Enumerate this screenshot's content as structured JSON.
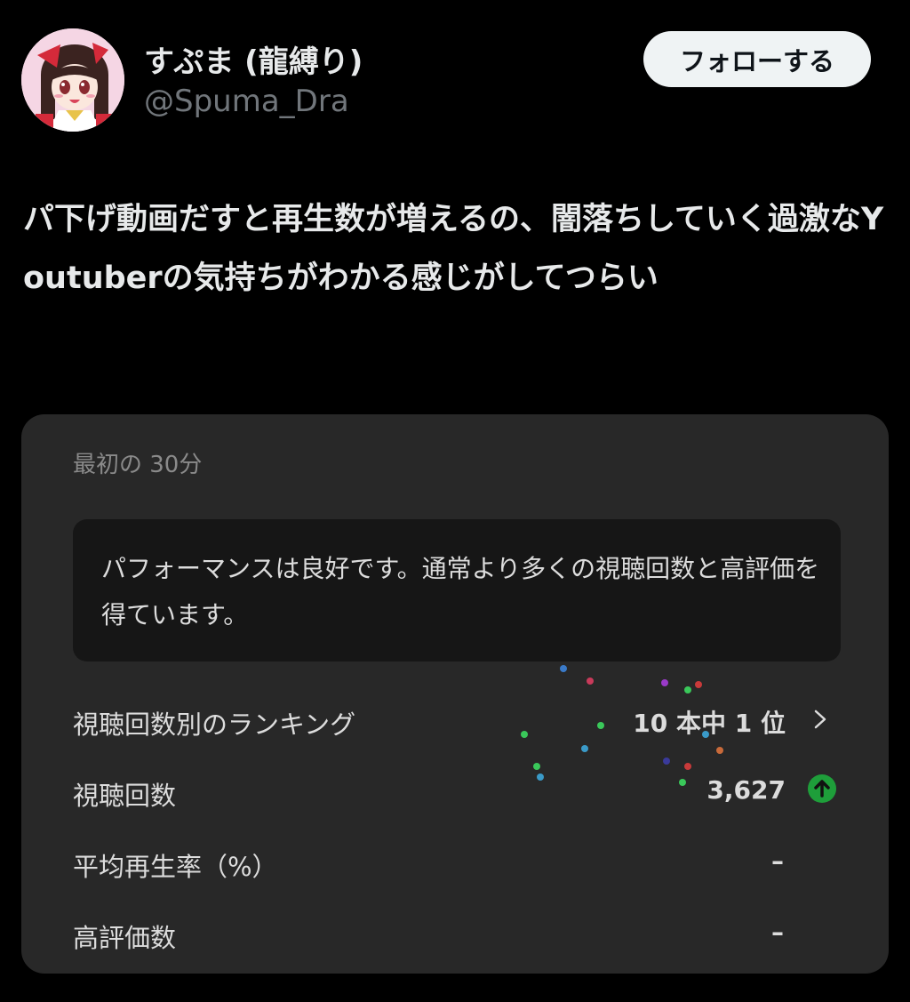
{
  "user": {
    "display_name": "すぷま (龍縛り)",
    "handle": "@Spuma_Dra",
    "avatar_icon": "avatar-image"
  },
  "follow_button": {
    "label": "フォローする"
  },
  "tweet": {
    "text": "パ下げ動画だすと再生数が増えるの、闇落ちしていく過激なYoutuberの気持ちがわかる感じがしてつらい"
  },
  "card": {
    "header": "最初の 30分",
    "performance_message": "パフォーマンスは良好です。通常より多くの視聴回数と高評価を得ています。",
    "rows": [
      {
        "label": "視聴回数別のランキング",
        "value": "10 本中 1 位",
        "icon": "chevron-right-icon"
      },
      {
        "label": "視聴回数",
        "value": "3,627",
        "icon": "arrow-up-circle-icon"
      },
      {
        "label": "平均再生率（%）",
        "value": "–"
      },
      {
        "label": "高評価数",
        "value": "–"
      }
    ]
  },
  "colors": {
    "background": "#000000",
    "card_background": "#282828",
    "performance_box": "#161616",
    "follow_button_bg": "#eff3f4",
    "up_arrow": "#1e9e3a",
    "handle": "#71767b"
  }
}
